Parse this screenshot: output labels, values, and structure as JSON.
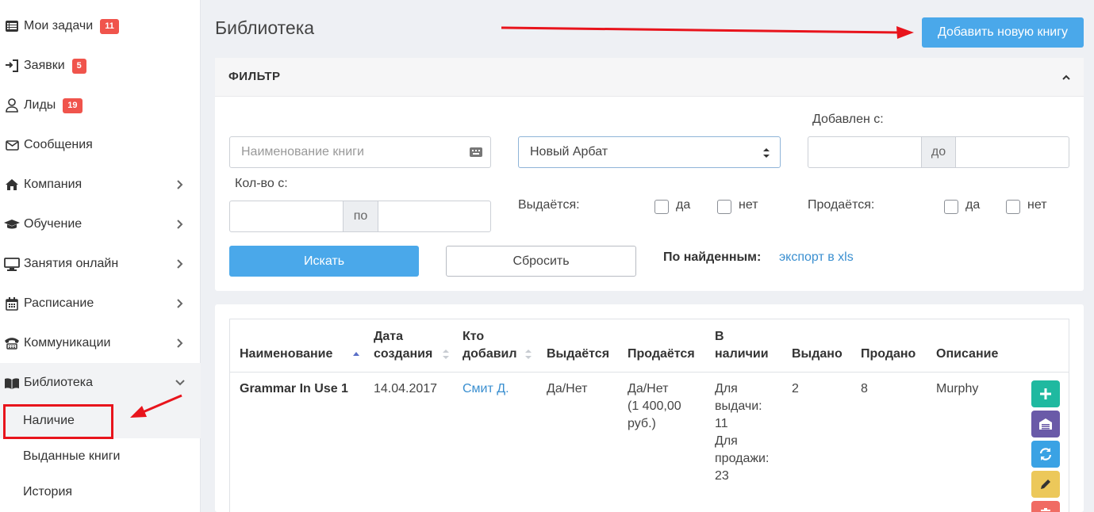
{
  "sidebar": {
    "items": [
      {
        "label": "Мои задачи",
        "badge": "11",
        "icon": "list-icon"
      },
      {
        "label": "Заявки",
        "badge": "5",
        "icon": "sign-in-icon"
      },
      {
        "label": "Лиды",
        "badge": "19",
        "icon": "user-icon"
      },
      {
        "label": "Сообщения",
        "icon": "envelope-icon"
      },
      {
        "label": "Компания",
        "icon": "home-icon"
      },
      {
        "label": "Обучение",
        "icon": "graduation-cap-icon"
      },
      {
        "label": "Занятия онлайн",
        "icon": "monitor-icon"
      },
      {
        "label": "Расписание",
        "icon": "calendar-icon"
      },
      {
        "label": "Коммуникации",
        "icon": "phone-icon"
      },
      {
        "label": "Библиотека",
        "icon": "book-icon"
      }
    ],
    "subitems": [
      {
        "label": "Наличие"
      },
      {
        "label": "Выданные книги"
      },
      {
        "label": "История"
      }
    ]
  },
  "header": {
    "title": "Библиотека",
    "add_button": "Добавить новую книгу"
  },
  "filter": {
    "title": "ФИЛЬТР",
    "name_placeholder": "Наименование книги",
    "branch_value": "Новый Арбат",
    "added_from_label": "Добавлен с:",
    "to_label": "до",
    "qty_from_label": "Кол-во с:",
    "qty_to_label": "по",
    "issued_label": "Выдаётся:",
    "sold_label": "Продаётся:",
    "yes": "да",
    "no": "нет",
    "search_button": "Искать",
    "reset_button": "Сбросить",
    "found_label": "По найденным:",
    "export_link": "экспорт в xls"
  },
  "table": {
    "headers": {
      "name": "Наименование",
      "date_l1": "Дата",
      "date_l2": "создания",
      "who_l1": "Кто",
      "who_l2": "добавил",
      "issued": "Выдаётся",
      "sold": "Продаётся",
      "stock_l1": "В",
      "stock_l2": "наличии",
      "given": "Выдано",
      "soldcount": "Продано",
      "desc": "Описание"
    },
    "rows": [
      {
        "name": "Grammar In Use 1",
        "date": "14.04.2017",
        "who": "Смит Д.",
        "issued": "Да/Нет",
        "sold_l1": "Да/Нет",
        "sold_l2": "(1 400,00",
        "sold_l3": "руб.)",
        "stock_l1": "Для",
        "stock_l2": "выдачи:",
        "stock_l3": "11",
        "stock_l4": "Для",
        "stock_l5": "продажи:",
        "stock_l6": "23",
        "given": "2",
        "soldcount": "8",
        "desc": "Murphy"
      }
    ]
  },
  "colors": {
    "accent": "#4aa8ea",
    "badge": "#f0544c",
    "annotation": "#e8141c",
    "btn_green": "#1fb9a0",
    "btn_purple": "#6a5aa8",
    "btn_blue": "#3aa2e4",
    "btn_yellow": "#ecc85a",
    "btn_red": "#f06b63"
  }
}
